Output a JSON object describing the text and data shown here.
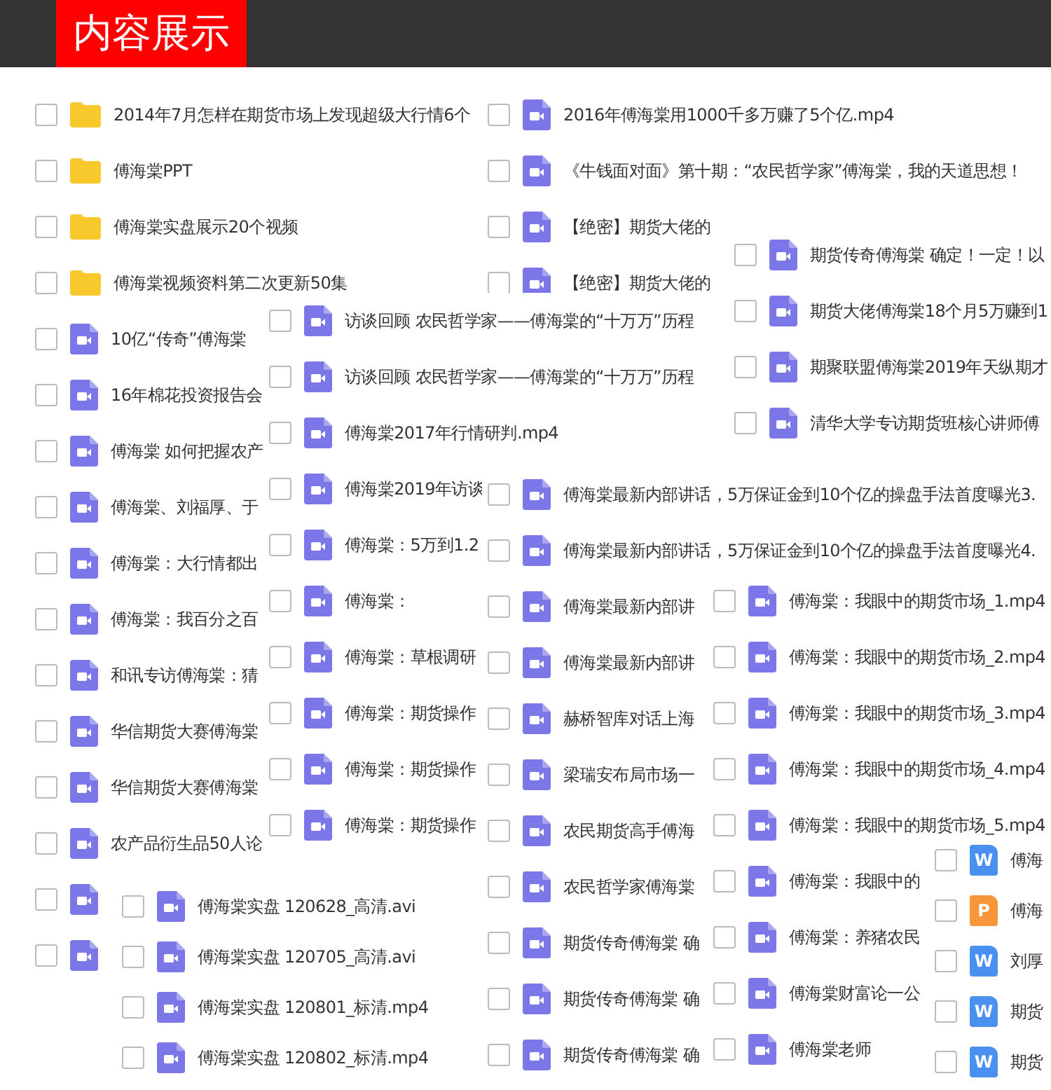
{
  "header": {
    "title": "内容展示"
  },
  "panels": [
    {
      "rows": [
        {
          "kind": "folder",
          "name": "2014年7月怎样在期货市场上发现超级大行情6个",
          "checked": false
        },
        {
          "kind": "folder",
          "name": "傅海棠PPT",
          "checked": false
        },
        {
          "kind": "folder",
          "name": "傅海棠实盘展示20个视频",
          "checked": false
        },
        {
          "kind": "folder",
          "name": "傅海棠视频资料第二次更新50集",
          "checked": false
        },
        {
          "kind": "video",
          "name": "10亿“传奇”傅海棠",
          "checked": false
        },
        {
          "kind": "video",
          "name": "16年棉花投资报告会",
          "checked": false
        },
        {
          "kind": "video",
          "name": "傅海棠 如何把握农产",
          "checked": false
        },
        {
          "kind": "video",
          "name": "傅海棠、刘福厚、于",
          "checked": false
        },
        {
          "kind": "video",
          "name": "傅海棠：大行情都出",
          "checked": false
        },
        {
          "kind": "video",
          "name": "傅海棠：我百分之百",
          "checked": false
        },
        {
          "kind": "video",
          "name": "和讯专访傅海棠：猜",
          "checked": false
        },
        {
          "kind": "video",
          "name": "华信期货大赛傅海棠",
          "checked": false
        },
        {
          "kind": "video",
          "name": "华信期货大赛傅海棠",
          "checked": false
        },
        {
          "kind": "video",
          "name": "农产品衍生品50人论",
          "checked": false
        },
        {
          "kind": "video",
          "checked": false
        },
        {
          "kind": "video",
          "checked": false
        }
      ]
    },
    {
      "rows": [
        {
          "kind": "video",
          "name": "2016年傅海棠用1000千多万赚了5个亿.mp4",
          "checked": false
        },
        {
          "kind": "video",
          "name": "《牛钱面对面》第十期：“农民哲学家”傅海棠，我的天道思想！",
          "checked": false
        },
        {
          "kind": "video",
          "name": "【绝密】期货大佬的",
          "checked": false
        },
        {
          "kind": "video",
          "name": "【绝密】期货大佬的",
          "checked": false
        }
      ]
    },
    {
      "rows": [
        {
          "kind": "video",
          "name": "访谈回顾  农民哲学家——傅海棠的“十万万”历程",
          "checked": false
        },
        {
          "kind": "video",
          "name": "访谈回顾  农民哲学家——傅海棠的“十万万”历程",
          "checked": false
        },
        {
          "kind": "video",
          "name": "傅海棠2017年行情研判.mp4",
          "checked": false
        },
        {
          "kind": "video",
          "name": "傅海棠2019年访谈",
          "checked": false
        },
        {
          "kind": "video",
          "name": "傅海棠：5万到1.2",
          "checked": false
        },
        {
          "kind": "video",
          "name": "傅海棠：",
          "checked": false
        },
        {
          "kind": "video",
          "name": "傅海棠：草根调研",
          "checked": false
        },
        {
          "kind": "video",
          "name": "傅海棠：期货操作",
          "checked": false
        },
        {
          "kind": "video",
          "name": "傅海棠：期货操作",
          "checked": false
        },
        {
          "kind": "video",
          "name": "傅海棠：期货操作",
          "checked": false
        }
      ]
    },
    {
      "rows": [
        {
          "kind": "video",
          "name": "期货传奇傅海棠 确定！一定！以",
          "checked": false
        },
        {
          "kind": "video",
          "name": "期货大佬傅海棠18个月5万赚到1",
          "checked": false
        },
        {
          "kind": "video",
          "name": "期聚联盟傅海棠2019年天纵期才",
          "checked": false
        },
        {
          "kind": "video",
          "name": "清华大学专访期货班核心讲师傅",
          "checked": false
        }
      ]
    },
    {
      "rows": [
        {
          "kind": "video",
          "name": "傅海棠实盘 120628_高清.avi",
          "checked": false
        },
        {
          "kind": "video",
          "name": "傅海棠实盘 120705_高清.avi",
          "checked": false
        },
        {
          "kind": "video",
          "name": "傅海棠实盘 120801_标清.mp4",
          "checked": false
        },
        {
          "kind": "video",
          "name": "傅海棠实盘 120802_标清.mp4",
          "checked": false
        }
      ]
    },
    {
      "rows": [
        {
          "kind": "video",
          "name": "傅海棠最新内部讲话，5万保证金到10个亿的操盘手法首度曝光3.",
          "checked": false
        },
        {
          "kind": "video",
          "name": "傅海棠最新内部讲话，5万保证金到10个亿的操盘手法首度曝光4.",
          "checked": false
        },
        {
          "kind": "video",
          "name": "傅海棠最新内部讲",
          "checked": false
        },
        {
          "kind": "video",
          "name": "傅海棠最新内部讲",
          "checked": false
        },
        {
          "kind": "video",
          "name": "赫桥智库对话上海",
          "checked": false
        },
        {
          "kind": "video",
          "name": "梁瑞安布局市场一",
          "checked": false
        },
        {
          "kind": "video",
          "name": "农民期货高手傅海",
          "checked": false
        },
        {
          "kind": "video",
          "name": "农民哲学家傅海棠",
          "checked": false
        },
        {
          "kind": "video",
          "name": "期货传奇傅海棠 确",
          "checked": false
        },
        {
          "kind": "video",
          "name": "期货传奇傅海棠 确",
          "checked": false
        },
        {
          "kind": "video",
          "name": "期货传奇傅海棠 确",
          "checked": false
        }
      ]
    },
    {
      "rows": [
        {
          "kind": "video",
          "name": "傅海棠：我眼中的期货市场_1.mp4",
          "checked": false
        },
        {
          "kind": "video",
          "name": "傅海棠：我眼中的期货市场_2.mp4",
          "checked": false
        },
        {
          "kind": "video",
          "name": "傅海棠：我眼中的期货市场_3.mp4",
          "checked": false
        },
        {
          "kind": "video",
          "name": "傅海棠：我眼中的期货市场_4.mp4",
          "checked": false
        },
        {
          "kind": "video",
          "name": "傅海棠：我眼中的期货市场_5.mp4",
          "checked": false
        },
        {
          "kind": "video",
          "name": "傅海棠：我眼中的",
          "checked": false
        },
        {
          "kind": "video",
          "name": "傅海棠：养猪农民",
          "checked": false
        },
        {
          "kind": "video",
          "name": "傅海棠财富论一公",
          "checked": false
        },
        {
          "kind": "video",
          "name": "傅海棠老师",
          "checked": false
        }
      ]
    },
    {
      "rows": [
        {
          "kind": "doc",
          "icon_letter": "W",
          "name": "傅海",
          "checked": false
        },
        {
          "kind": "slides",
          "icon_letter": "P",
          "name": "傅海",
          "checked": false
        },
        {
          "kind": "doc",
          "icon_letter": "W",
          "name": "刘厚",
          "checked": false
        },
        {
          "kind": "doc",
          "icon_letter": "W",
          "name": "期货",
          "checked": false
        },
        {
          "kind": "doc",
          "icon_letter": "W",
          "name": "期货",
          "checked": false
        }
      ]
    }
  ]
}
